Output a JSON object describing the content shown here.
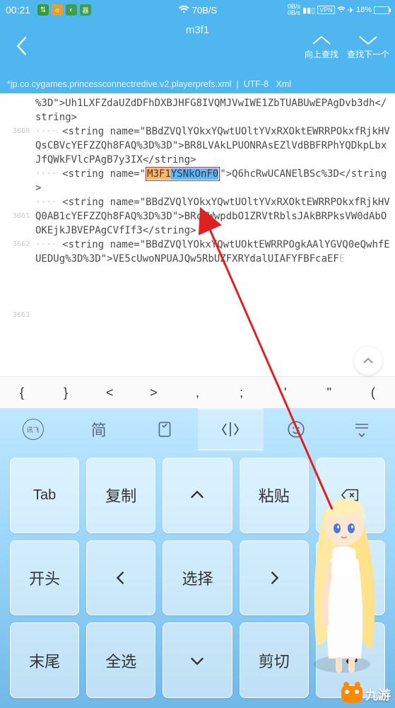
{
  "status": {
    "time": "00:21",
    "net_speed": "70B/S",
    "up_speed": "0B/s",
    "down_speed": "0B/s",
    "vpn": "VPN",
    "battery_pct": "18%"
  },
  "header": {
    "title": "m3f1",
    "action_prev": "向上查找",
    "action_next": "查找下一个"
  },
  "subheader": {
    "filename": "*jp.co.cygames.princessconnectredive.v2.playerprefs.xml",
    "encoding": "UTF-8",
    "filetype": "Xml"
  },
  "gutter": [
    "3660",
    "3661",
    "3662",
    "3663"
  ],
  "code": {
    "line_pre": "%3D\">Uh1LXFZdaUZdDFhDXBJHFG8IVQMJVwIWE1ZbTUABUwEPAgDvb3dh</string>",
    "l3660": "    <string name=\"BBdZVQlYOkxYQwtUOltYVxRXOktEWRRPOkxfRjkHVQsCBVcYEFZZQh8FAQ%3D%3D\">BR8LVAkLPUONRAsEZlVdBBFRPhYQDkpLbxJfQWkFVlcPAgB7y3IX</string>",
    "l3661_pre": "    <string name=\"",
    "l3661_hl_a": "M3F1",
    "l3661_hl_b": "YSNkOnF0",
    "l3661_post": "\">Q6hcRwUCANElBSc%3D</string>",
    "l3662": "    <string name=\"BBdZVQlYOkxYQwtUOltYVxRXOktEWRRPOkxfRjkHVQ0AB1cYEFZZQh8FAQ%3D%3D\">BRcMWwpdbO1ZRVtRblsJAkBRPksVW0dAbOOKEjkJBVEPAgCVfIf3</string>",
    "l3663": "    <string name=\"BBdZVQlYOkxYQwtUOktEWRRPOgkAAlYGVQ0eQwhfEUEDUg%3D%3D\">VE5cUwoNPUAJQw5RbUZFXRYdalUIAFYFBFcaEF",
    "l3663_tail": "E"
  },
  "symrow": [
    "{",
    "}",
    "<",
    ">",
    ",",
    ";",
    "'",
    "\"",
    "("
  ],
  "kbd_toolbar": {
    "logo": "讯飞",
    "simp": "简"
  },
  "keys": {
    "tab": "Tab",
    "copy": "复制",
    "paste": "粘贴",
    "home": "开头",
    "select": "选择",
    "del": "Del",
    "end": "末尾",
    "select_all": "全选",
    "cut": "剪切"
  },
  "watermark": "九游"
}
